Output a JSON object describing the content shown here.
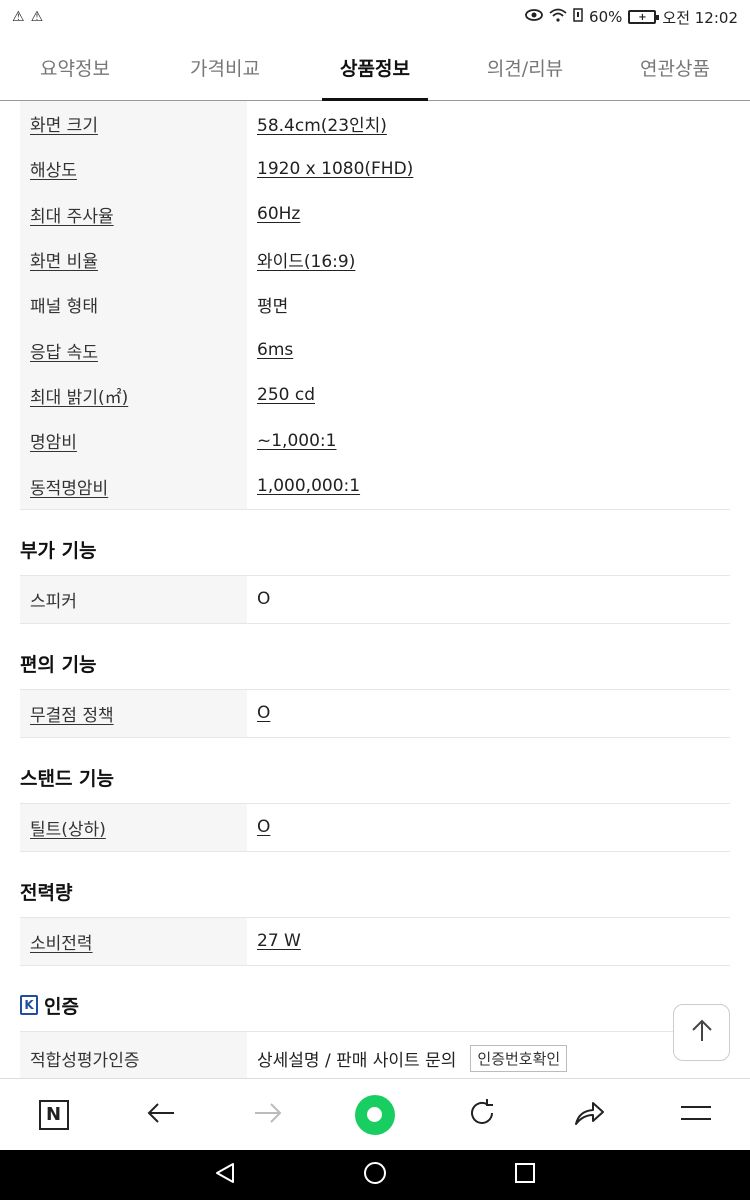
{
  "status": {
    "battery": "60%",
    "time": "오전 12:02"
  },
  "tabs": [
    {
      "label": "요약정보"
    },
    {
      "label": "가격비교"
    },
    {
      "label": "상품정보"
    },
    {
      "label": "의견/리뷰"
    },
    {
      "label": "연관상품"
    }
  ],
  "specs": [
    {
      "key": "화면 크기",
      "value": "58.4cm(23인치)"
    },
    {
      "key": "해상도",
      "value": "1920 x 1080(FHD)"
    },
    {
      "key": "최대 주사율",
      "value": "60Hz"
    },
    {
      "key": "화면 비율",
      "value": "와이드(16:9)"
    },
    {
      "key": "패널 형태",
      "value": "평면"
    },
    {
      "key": "응답 속도",
      "value": "6ms"
    },
    {
      "key": "최대 밝기(㎡)",
      "value": "250 cd"
    },
    {
      "key": "명암비",
      "value": "~1,000:1"
    },
    {
      "key": "동적명암비",
      "value": "1,000,000:1"
    }
  ],
  "sections": [
    {
      "title": "부가 기능",
      "rows": [
        {
          "key": "스피커",
          "value": "O"
        }
      ]
    },
    {
      "title": "편의 기능",
      "rows": [
        {
          "key": "무결점 정책",
          "value": "O"
        }
      ]
    },
    {
      "title": "스탠드 기능",
      "rows": [
        {
          "key": "틸트(상하)",
          "value": "O"
        }
      ]
    },
    {
      "title": "전력량",
      "rows": [
        {
          "key": "소비전력",
          "value": "27 W"
        }
      ]
    }
  ],
  "cert": {
    "title": "인증",
    "key": "적합성평가인증",
    "value": "상세설명 / 판매 사이트 문의",
    "button": "인증번호확인"
  },
  "colors": {
    "accent_green": "#19ce60",
    "kc_blue": "#1f4ea3"
  }
}
